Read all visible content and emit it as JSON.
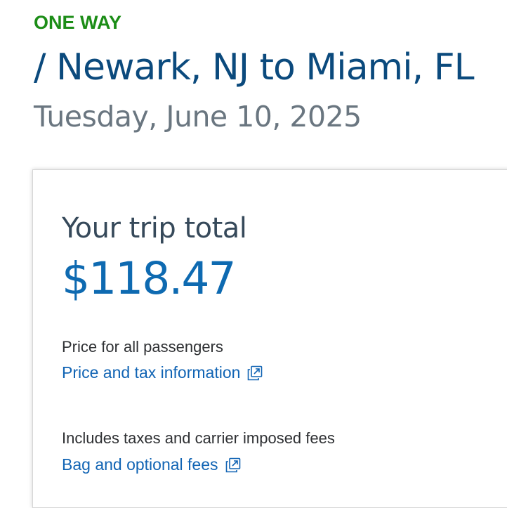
{
  "trip": {
    "type_label": "ONE WAY",
    "route": "/ Newark, NJ to Miami, FL",
    "date": "Tuesday, June 10, 2025"
  },
  "summary": {
    "total_label": "Your trip total",
    "total_amount": "$118.47",
    "passengers_note": "Price for all passengers",
    "price_tax_link": "Price and tax information",
    "fees_note": "Includes taxes and carrier imposed fees",
    "bag_fees_link": "Bag and optional fees"
  },
  "icons": {
    "external_link": "external-link-icon"
  },
  "colors": {
    "trip_type": "#1c8d17",
    "route": "#0b4a7d",
    "date": "#6a7680",
    "total_amount": "#0e6ab1",
    "link": "#1164b4"
  }
}
